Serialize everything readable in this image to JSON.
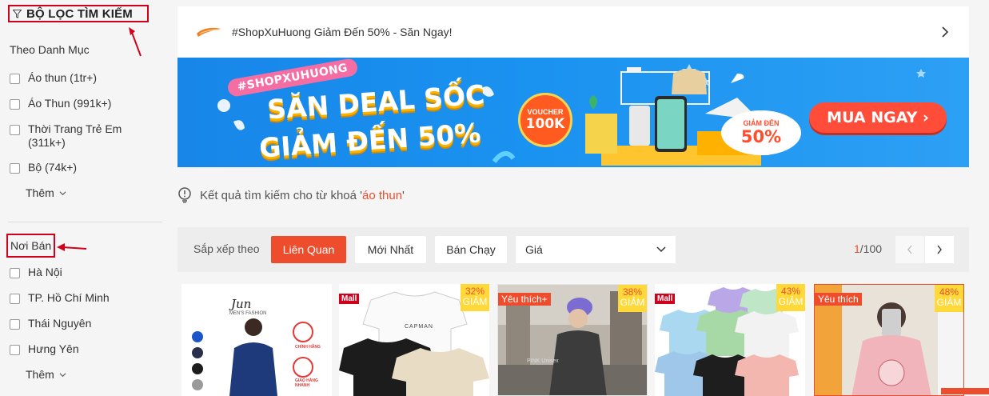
{
  "sidebar": {
    "filter_title": "BỘ LỌC TÌM KIẾM",
    "category_title": "Theo Danh Mục",
    "categories": [
      {
        "label": "Áo thun (1tr+)"
      },
      {
        "label": "Áo Thun (991k+)"
      },
      {
        "label": "Thời Trang Trẻ Em\n(311k+)"
      },
      {
        "label": "Bộ (74k+)"
      }
    ],
    "more_label": "Thêm",
    "location_title": "Nơi Bán",
    "locations": [
      {
        "label": "Hà Nội"
      },
      {
        "label": "TP. Hồ Chí Minh"
      },
      {
        "label": "Thái Nguyên"
      },
      {
        "label": "Hưng Yên"
      }
    ],
    "more_label_2": "Thêm"
  },
  "promo": {
    "text": "#ShopXuHuong Giảm Đến 50% - Săn Ngay!"
  },
  "banner": {
    "tag": "#SHOPXUHUONG",
    "line1": "SĂN DEAL SỐC",
    "line2": "GIẢM ĐẾN 50%",
    "voucher_label": "VOUCHER",
    "voucher_value": "100K",
    "discount_label": "GIẢM ĐẾN",
    "discount_value": "50%",
    "cta": "MUA NGAY ›"
  },
  "search_result": {
    "prefix": "Kết quả tìm kiếm cho từ khoá '",
    "keyword": "áo thun",
    "suffix": "'"
  },
  "sort": {
    "label": "Sắp xếp theo",
    "options": [
      "Liên Quan",
      "Mới Nhất",
      "Bán Chạy"
    ],
    "price_label": "Giá",
    "page_current": "1",
    "page_total": "/100"
  },
  "products": [
    {
      "brand": "Jun",
      "brand_sub": "MEN'S FASHION",
      "badges": [
        "CHÍNH HÃNG",
        "GIAO HÀNG NHANH"
      ]
    },
    {
      "tag": "Mall",
      "discount": "32%",
      "discount_label": "GIẢM",
      "print": "CAPMAN"
    },
    {
      "tag": "Yêu thích+",
      "discount": "38%",
      "discount_label": "GIẢM",
      "print": "PINK Unisex"
    },
    {
      "tag": "Mall",
      "discount": "43%",
      "discount_label": "GIẢM"
    },
    {
      "tag": "Yêu thích",
      "discount": "48%",
      "discount_label": "GIẢM"
    }
  ],
  "colors": {
    "accent": "#ee4d2d",
    "annotation": "#d0021b",
    "banner_blue": "#1a92f0"
  }
}
